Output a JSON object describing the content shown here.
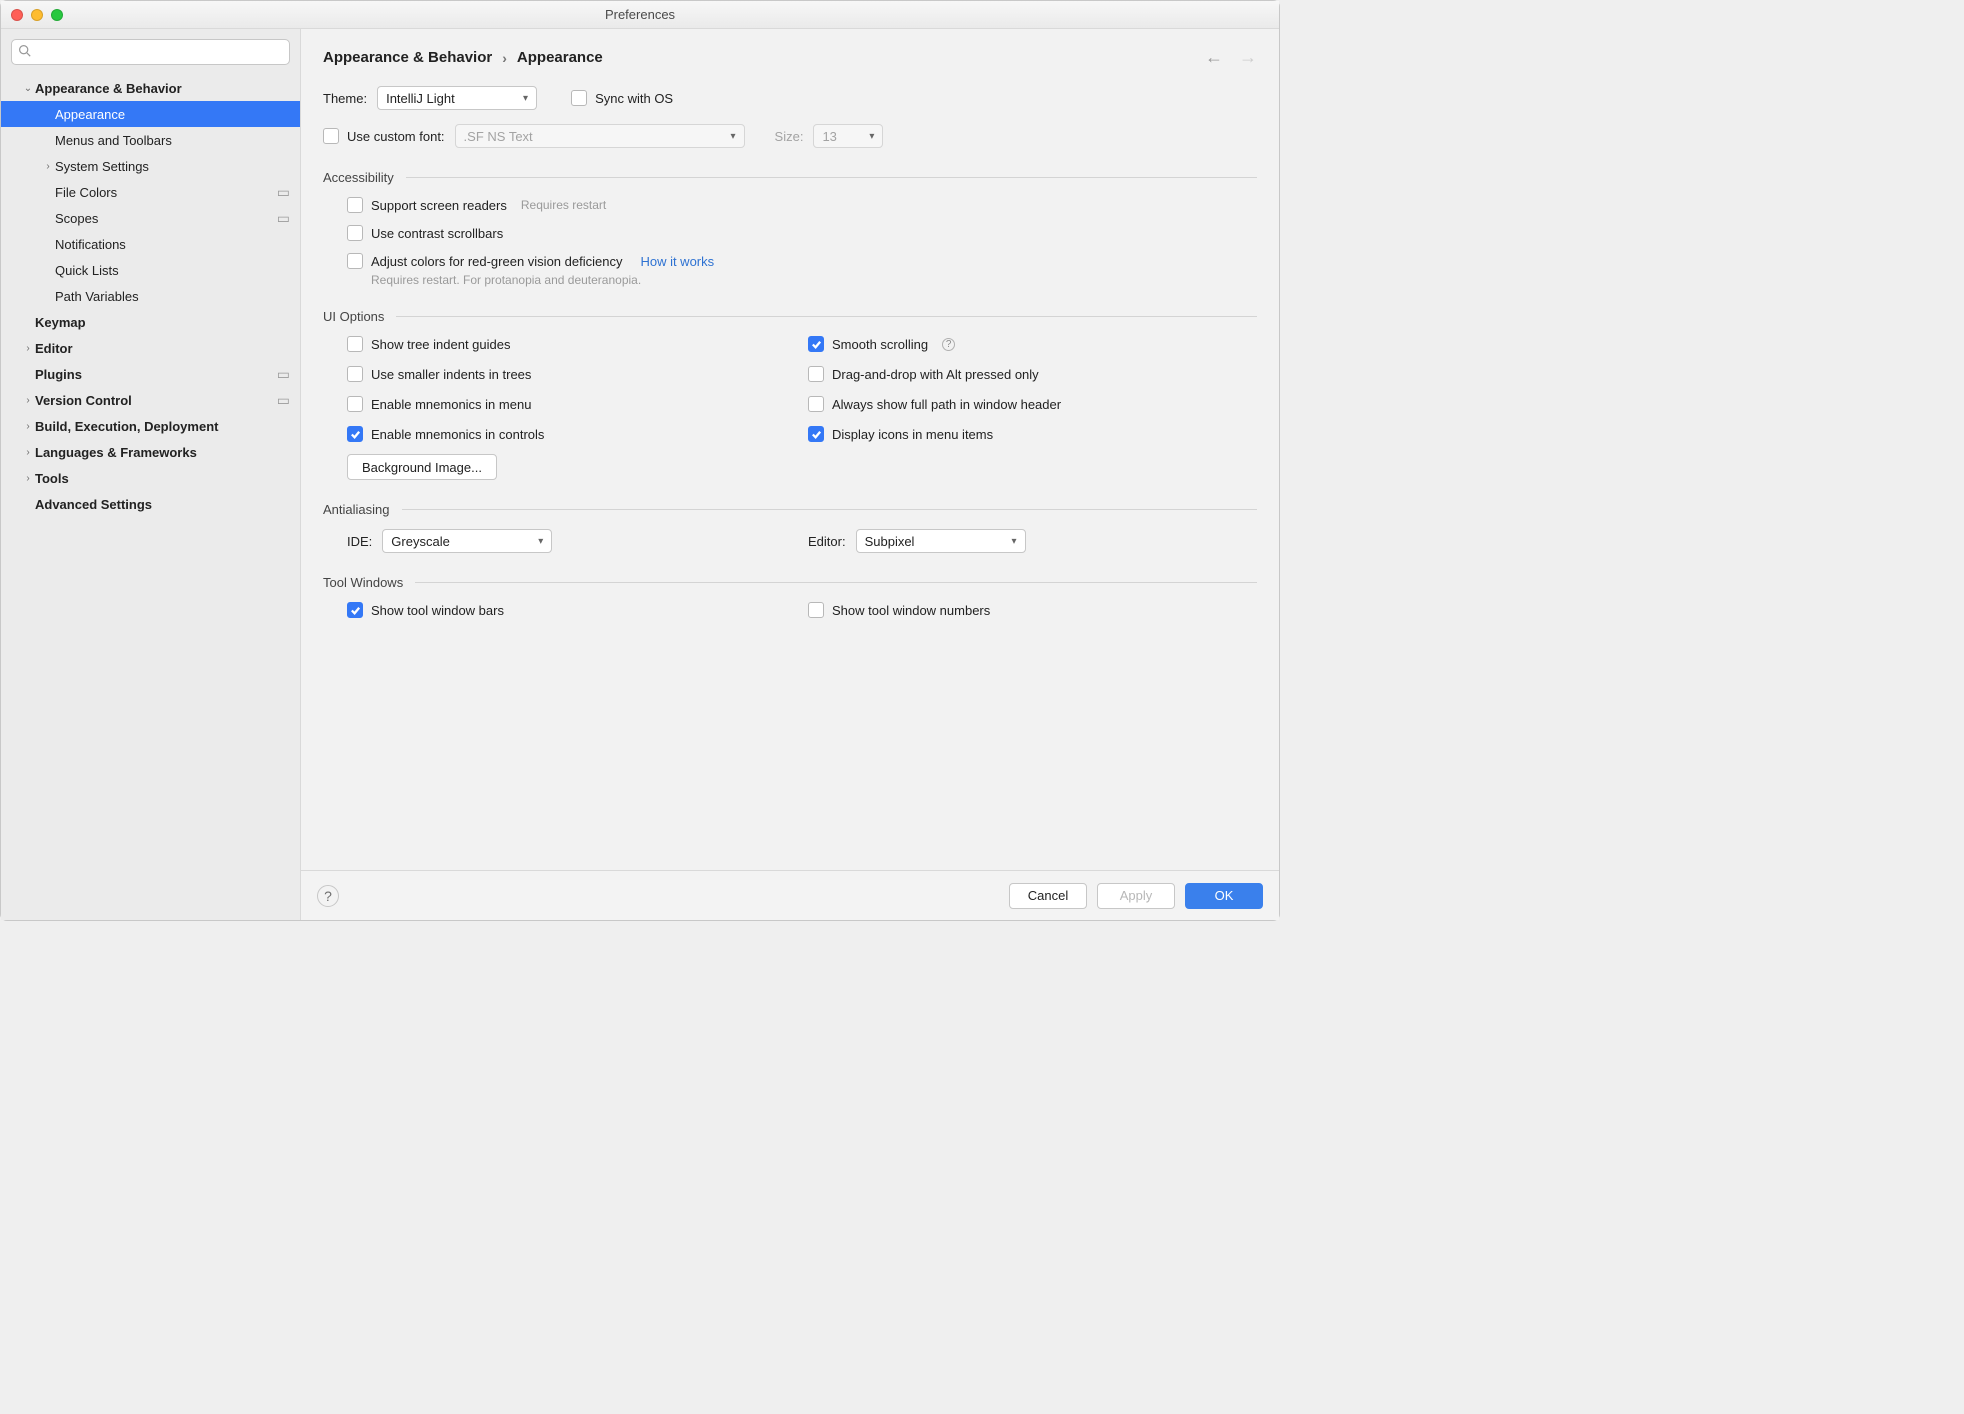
{
  "window": {
    "title": "Preferences"
  },
  "breadcrumb": {
    "parent": "Appearance & Behavior",
    "current": "Appearance"
  },
  "sidebar": {
    "search_placeholder": "",
    "items": [
      {
        "label": "Appearance & Behavior",
        "level": 1,
        "bold": true,
        "chevron": "down"
      },
      {
        "label": "Appearance",
        "level": 2,
        "selected": true
      },
      {
        "label": "Menus and Toolbars",
        "level": 2
      },
      {
        "label": "System Settings",
        "level": 2,
        "chevron": "right"
      },
      {
        "label": "File Colors",
        "level": 2,
        "badge": true
      },
      {
        "label": "Scopes",
        "level": 2,
        "badge": true
      },
      {
        "label": "Notifications",
        "level": 2
      },
      {
        "label": "Quick Lists",
        "level": 2
      },
      {
        "label": "Path Variables",
        "level": 2
      },
      {
        "label": "Keymap",
        "level": 1,
        "bold": true
      },
      {
        "label": "Editor",
        "level": 1,
        "bold": true,
        "chevron": "right"
      },
      {
        "label": "Plugins",
        "level": 1,
        "bold": true,
        "badge": true
      },
      {
        "label": "Version Control",
        "level": 1,
        "bold": true,
        "chevron": "right",
        "badge": true
      },
      {
        "label": "Build, Execution, Deployment",
        "level": 1,
        "bold": true,
        "chevron": "right"
      },
      {
        "label": "Languages & Frameworks",
        "level": 1,
        "bold": true,
        "chevron": "right"
      },
      {
        "label": "Tools",
        "level": 1,
        "bold": true,
        "chevron": "right"
      },
      {
        "label": "Advanced Settings",
        "level": 1,
        "bold": true
      }
    ]
  },
  "theme": {
    "label": "Theme:",
    "value": "IntelliJ Light",
    "sync_label": "Sync with OS"
  },
  "custom_font": {
    "label": "Use custom font:",
    "font_value": ".SF NS Text",
    "size_label": "Size:",
    "size_value": "13"
  },
  "accessibility": {
    "title": "Accessibility",
    "screen_readers": "Support screen readers",
    "screen_readers_hint": "Requires restart",
    "contrast_scrollbars": "Use contrast scrollbars",
    "adjust_colors": "Adjust colors for red-green vision deficiency",
    "how_it_works": "How it works",
    "adjust_hint": "Requires restart. For protanopia and deuteranopia."
  },
  "ui_options": {
    "title": "UI Options",
    "tree_guides": "Show tree indent guides",
    "smooth_scrolling": "Smooth scrolling",
    "smaller_indents": "Use smaller indents in trees",
    "dnd_alt": "Drag-and-drop with Alt pressed only",
    "mnemonics_menu": "Enable mnemonics in menu",
    "full_path": "Always show full path in window header",
    "mnemonics_controls": "Enable mnemonics in controls",
    "icons_menu": "Display icons in menu items",
    "background_button": "Background Image..."
  },
  "antialiasing": {
    "title": "Antialiasing",
    "ide_label": "IDE:",
    "ide_value": "Greyscale",
    "editor_label": "Editor:",
    "editor_value": "Subpixel"
  },
  "tool_windows": {
    "title": "Tool Windows",
    "show_bars": "Show tool window bars",
    "show_numbers": "Show tool window numbers"
  },
  "footer": {
    "cancel": "Cancel",
    "apply": "Apply",
    "ok": "OK"
  }
}
